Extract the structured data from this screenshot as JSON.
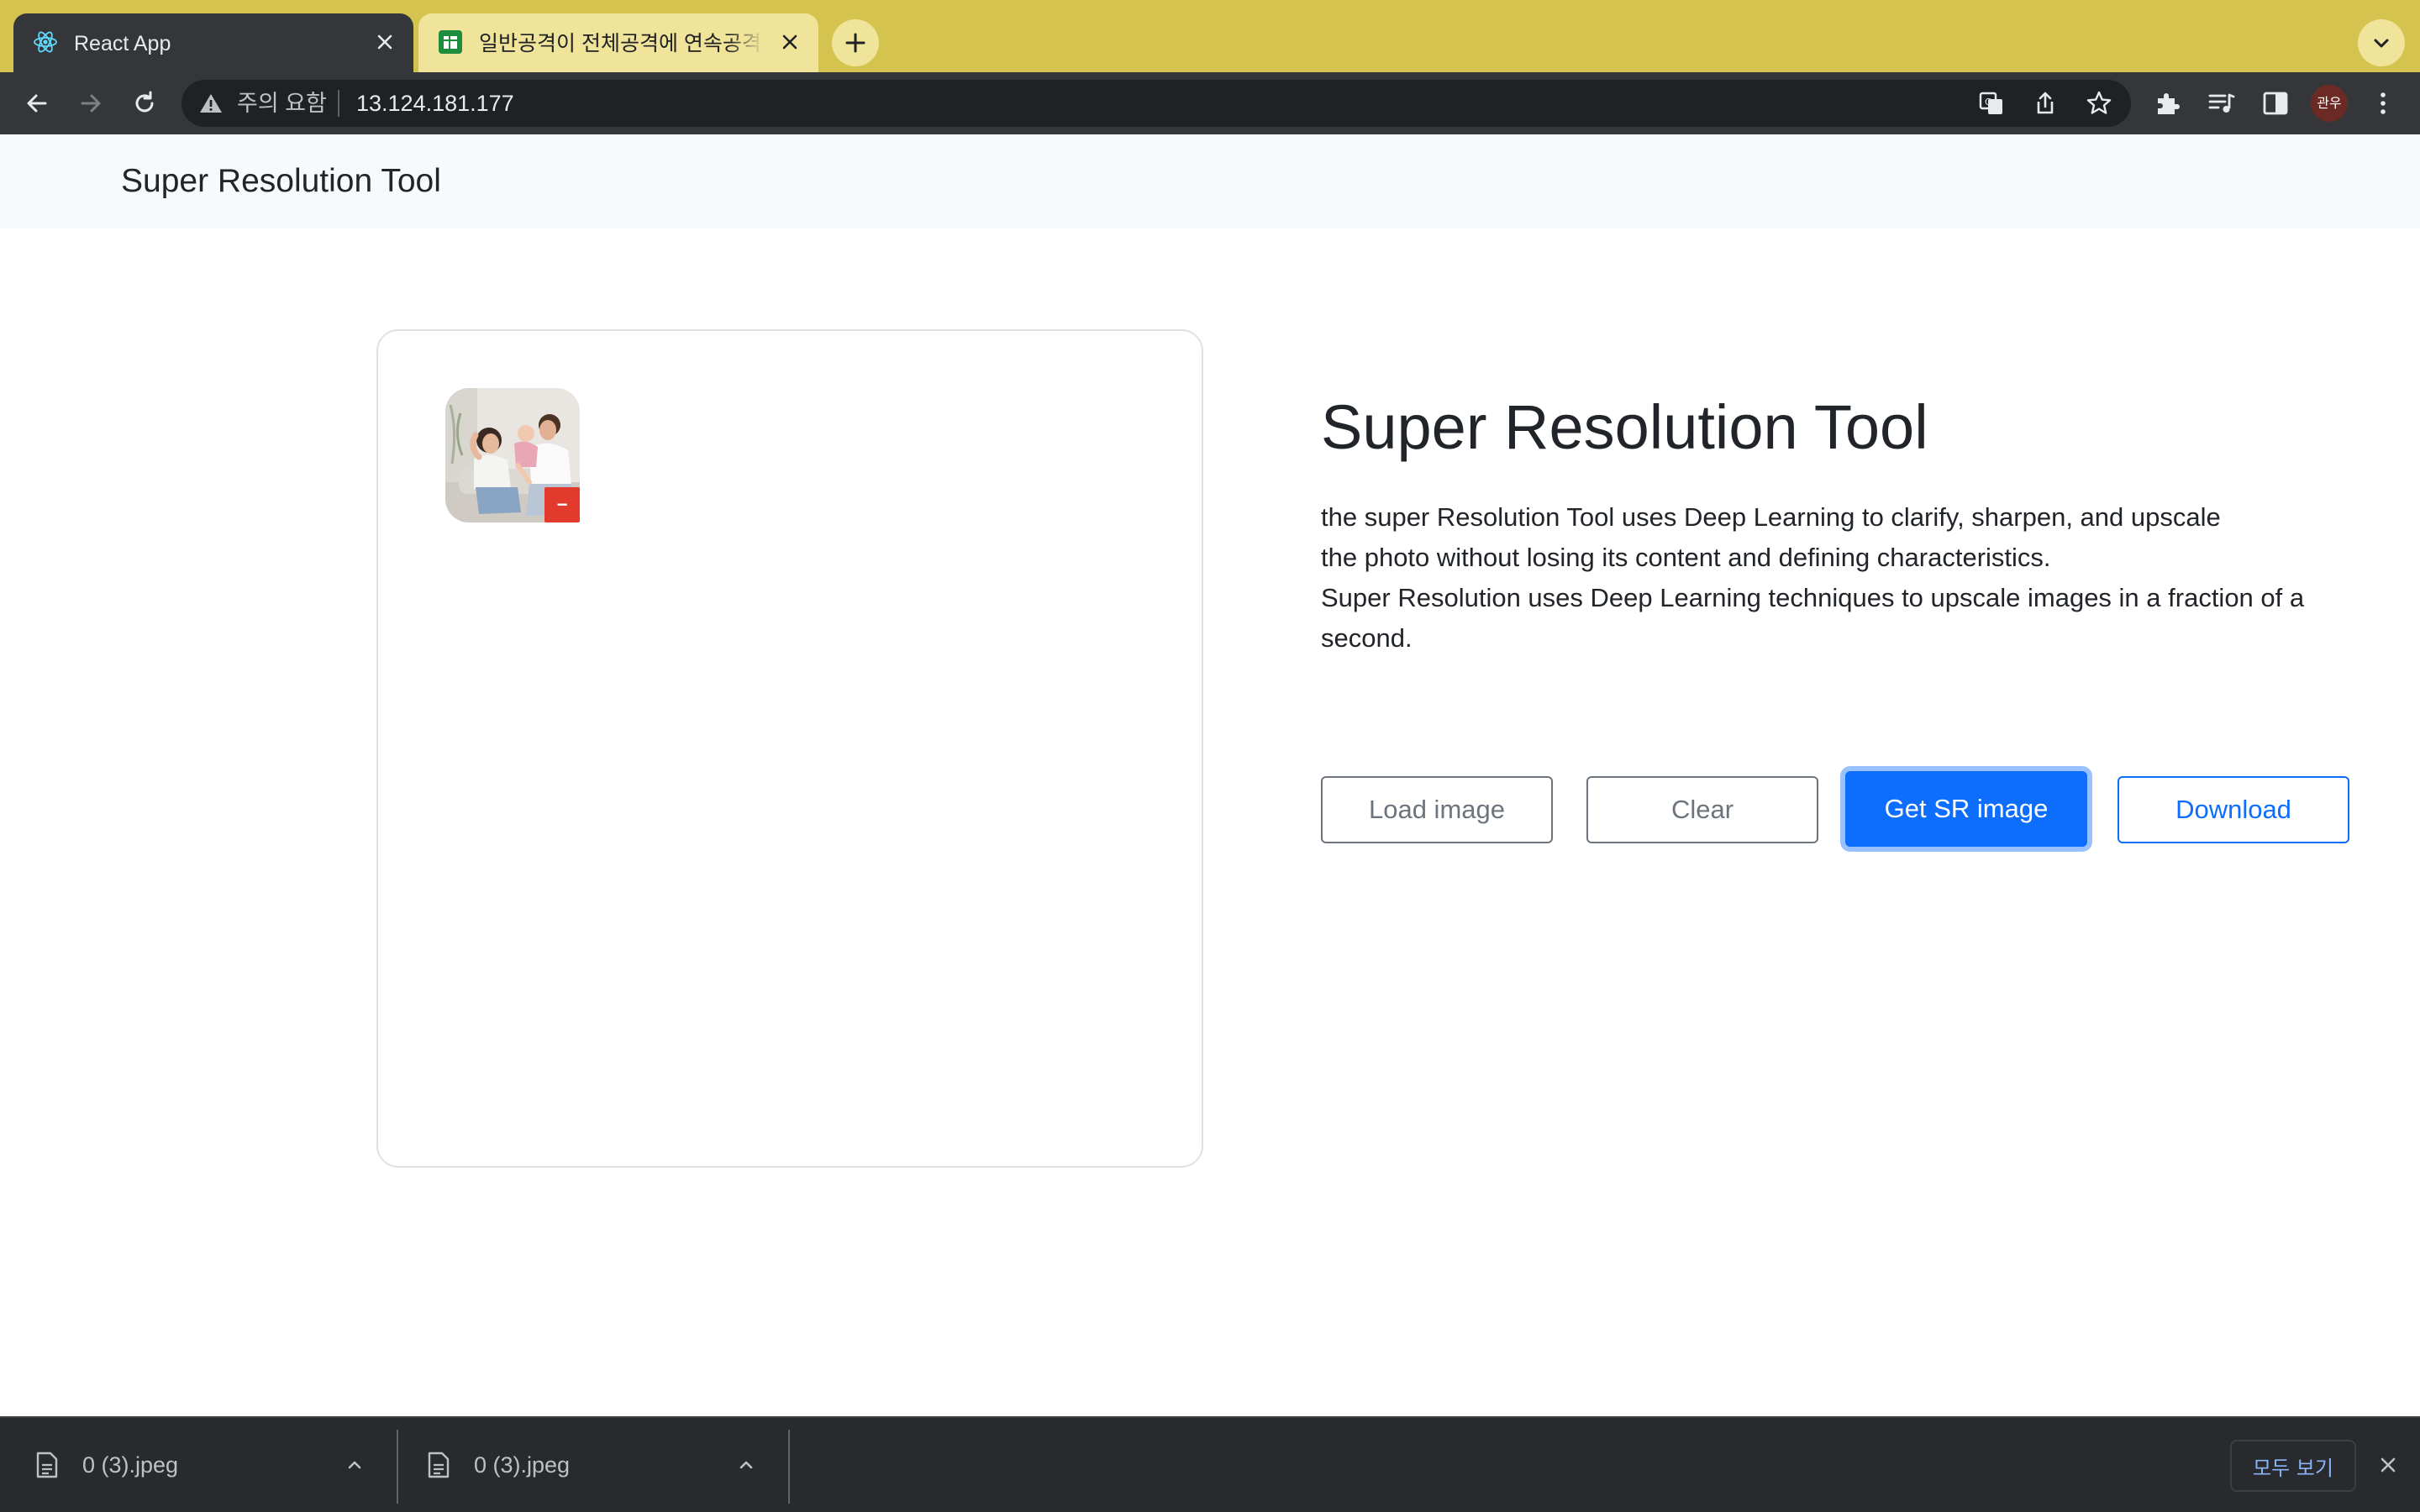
{
  "browser": {
    "tabs": [
      {
        "title": "React App",
        "favicon": "react-icon",
        "active": true
      },
      {
        "title": "일반공격이 전체공격에 연속공격인 안",
        "favicon": "google-sheets-icon",
        "active": false
      }
    ],
    "omnibox": {
      "security_text": "주의 요함",
      "url": "13.124.181.177"
    },
    "profile_label": "관우",
    "colors": {
      "tabstrip": "#d4c44f",
      "toolbar": "#35363a"
    }
  },
  "app": {
    "navbar_title": "Super Resolution Tool",
    "uploaded_image": {
      "remove_label": "−",
      "alt": "uploaded family photo thumbnail"
    },
    "hero_title": "Super Resolution Tool",
    "description_lines": [
      "the super Resolution Tool uses Deep Learning to clarify, sharpen, and upscale",
      "the photo without losing its content and defining characteristics.",
      "Super Resolution uses Deep Learning techniques to upscale images in a fraction of a",
      "second."
    ],
    "buttons": {
      "load": "Load image",
      "clear": "Clear",
      "get_sr": "Get SR image",
      "download": "Download"
    },
    "colors": {
      "primary": "#0d6efd",
      "secondary": "#6c757d",
      "danger": "#e23b2e"
    }
  },
  "downloads": {
    "items": [
      {
        "filename": "0 (3).jpeg"
      },
      {
        "filename": "0 (3).jpeg"
      }
    ],
    "show_all_label": "모두 보기"
  }
}
